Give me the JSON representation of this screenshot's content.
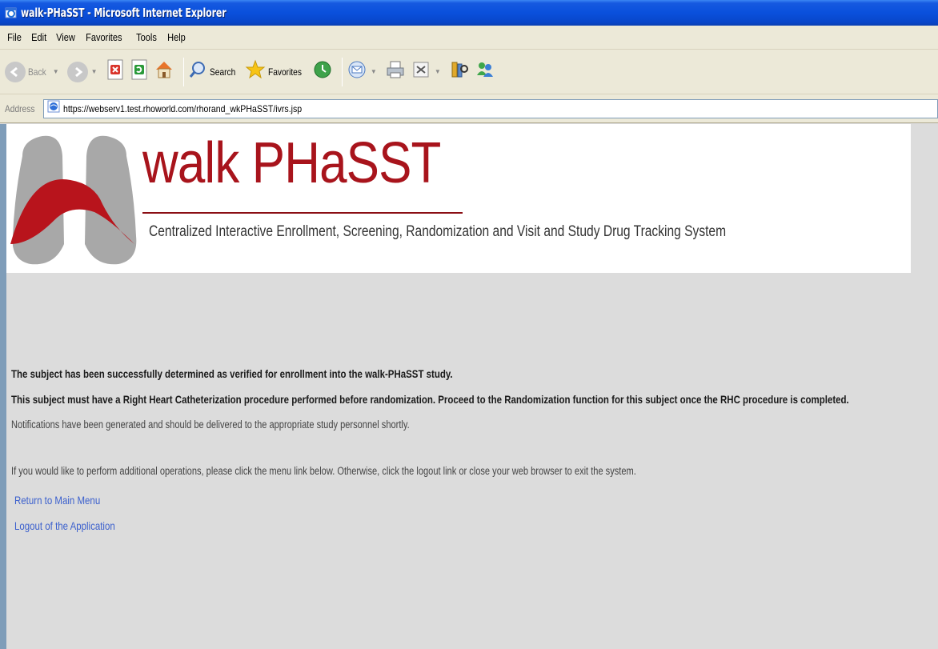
{
  "window": {
    "title": "walk-PHaSST - Microsoft Internet Explorer"
  },
  "menu": {
    "items": [
      "File",
      "Edit",
      "View",
      "Favorites",
      "Tools",
      "Help"
    ]
  },
  "toolbar": {
    "back_label": "Back",
    "search_label": "Search",
    "favorites_label": "Favorites"
  },
  "address": {
    "label": "Address",
    "url": "https://webserv1.test.rhoworld.com/rhorand_wkPHaSST/ivrs.jsp"
  },
  "banner": {
    "title": "walk PHaSST",
    "subtitle": "Centralized Interactive Enrollment, Screening, Randomization and Visit and Study Drug Tracking System"
  },
  "messages": {
    "verified": "The subject has been successfully determined as verified for enrollment into the walk-PHaSST study.",
    "rhc_required": "This subject must have a Right Heart Catheterization procedure performed before randomization. Proceed to the Randomization function for this subject once the RHC procedure is completed.",
    "notifications": "Notifications have been generated and should be delivered to the appropriate study personnel shortly.",
    "instructions": "If you would like to perform additional operations, please click the menu link below. Otherwise, click the logout link or close your web browser to exit the system."
  },
  "links": {
    "main_menu": "Return to Main Menu",
    "logout": "Logout of the Application"
  },
  "colors": {
    "brand_red": "#a8141c",
    "link_blue": "#3a5fcd",
    "titlebar_blue": "#0a50dc"
  }
}
